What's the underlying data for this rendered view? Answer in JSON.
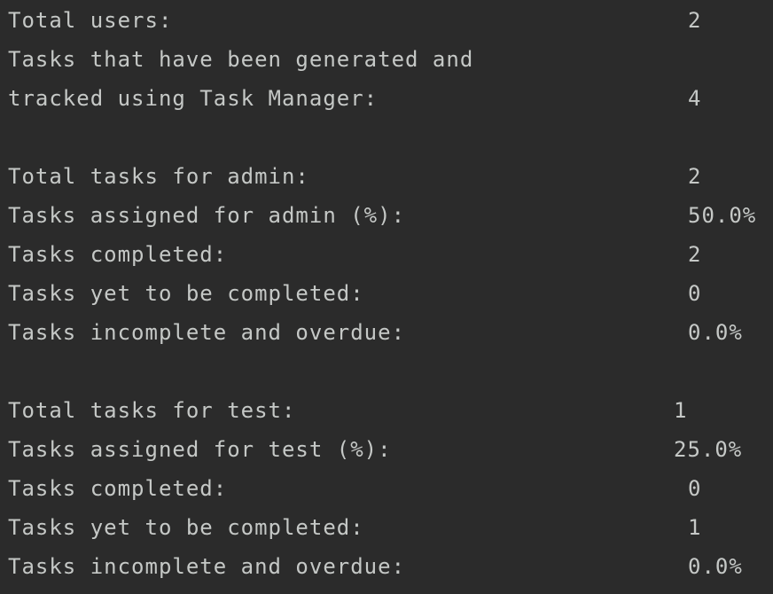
{
  "summary": {
    "total_users_label": "Total users:",
    "total_users_value": "2",
    "tasks_generated_label_line1": "Tasks that have been generated and",
    "tasks_generated_label_line2": "tracked using Task Manager:",
    "tasks_generated_value": "4"
  },
  "users": [
    {
      "total_label": "Total tasks for admin:",
      "total_value": "2",
      "assigned_label": "Tasks assigned for admin (%):",
      "assigned_value": "50.0%",
      "completed_label": "Tasks completed:",
      "completed_value": "2",
      "yet_label": "Tasks yet to be completed:",
      "yet_value": "0",
      "overdue_label": "Tasks incomplete and overdue:",
      "overdue_value": "0.0%"
    },
    {
      "total_label": "Total tasks for test:",
      "total_value": "1",
      "assigned_label": "Tasks assigned for test (%):",
      "assigned_value": "25.0%",
      "completed_label": "Tasks completed:",
      "completed_value": "0",
      "yet_label": "Tasks yet to be completed:",
      "yet_value": "1",
      "overdue_label": "Tasks incomplete and overdue:",
      "overdue_value": "0.0%"
    }
  ]
}
